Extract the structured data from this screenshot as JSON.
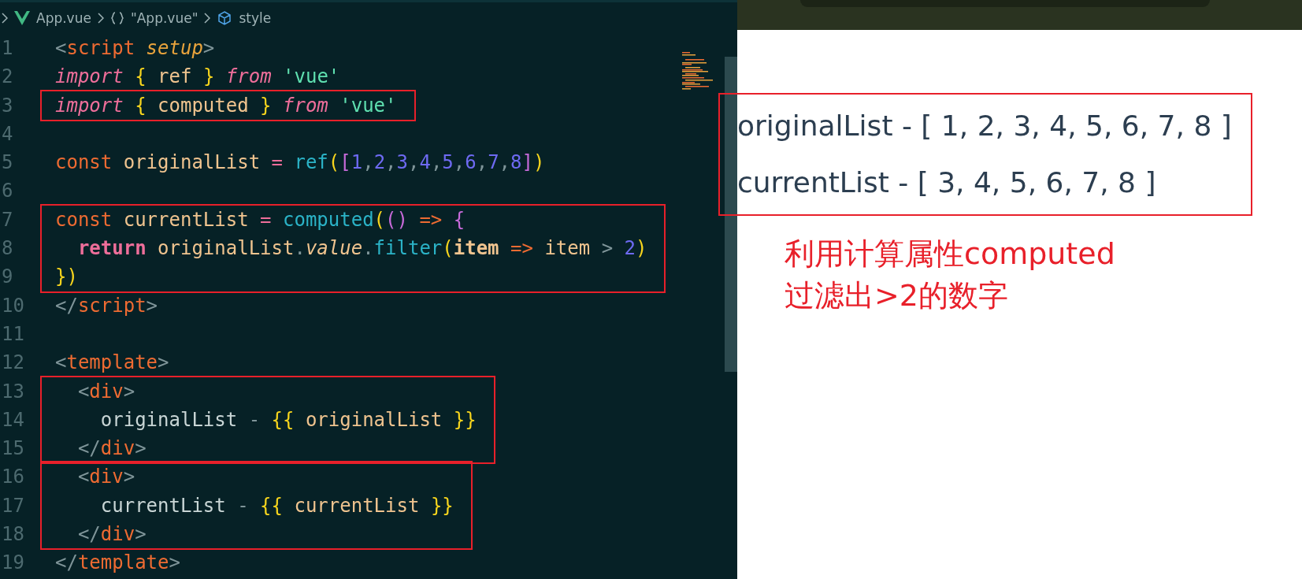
{
  "breadcrumb": [
    {
      "kind": "vue",
      "label": "App.vue"
    },
    {
      "kind": "braces",
      "label": "\"App.vue\""
    },
    {
      "kind": "cube",
      "label": "style"
    }
  ],
  "code_blocks": [
    {
      "boxed": false,
      "lines": [
        {
          "number": "1",
          "text": "<script setup>"
        },
        {
          "number": "2",
          "text": "import { ref } from 'vue'"
        }
      ]
    },
    {
      "boxed": true,
      "lines": [
        {
          "number": "3",
          "text": "import { computed } from 'vue'"
        }
      ]
    },
    {
      "boxed": false,
      "lines": [
        {
          "number": "4"
        },
        {
          "number": "5",
          "text": "const originalList = ref([1,2,3,4,5,6,7,8])"
        },
        {
          "number": "6"
        }
      ]
    },
    {
      "boxed": true,
      "lines": [
        {
          "number": "7",
          "text": "const currentList = computed(() => {"
        },
        {
          "number": "8",
          "text": "  return originalList.value.filter(item => item > 2)"
        },
        {
          "number": "9",
          "text": "})"
        }
      ]
    },
    {
      "boxed": false,
      "lines": [
        {
          "number": "10",
          "text": "</script>"
        },
        {
          "number": "11"
        },
        {
          "number": "12",
          "text": "<template>"
        }
      ]
    },
    {
      "boxed": true,
      "lines": [
        {
          "number": "13",
          "text": "  <div>"
        },
        {
          "number": "14",
          "text": "    originalList - {{ originalList }}"
        },
        {
          "number": "15",
          "text": "  </div>"
        }
      ]
    },
    {
      "boxed": true,
      "lines": [
        {
          "number": "16",
          "text": "  <div>"
        },
        {
          "number": "17",
          "text": "    currentList - {{ currentList }}"
        },
        {
          "number": "18",
          "text": "  </div>"
        }
      ]
    },
    {
      "boxed": false,
      "lines": [
        {
          "number": "19",
          "text": "</template>"
        }
      ]
    }
  ],
  "preview": {
    "output_lines": [
      "originalList - [ 1, 2, 3, 4, 5, 6, 7, 8 ]",
      "currentList - [ 3, 4, 5, 6, 7, 8 ]"
    ],
    "output_boxed": true,
    "annotation": [
      "利用计算属性computed",
      "过滤出>2的数字"
    ]
  }
}
